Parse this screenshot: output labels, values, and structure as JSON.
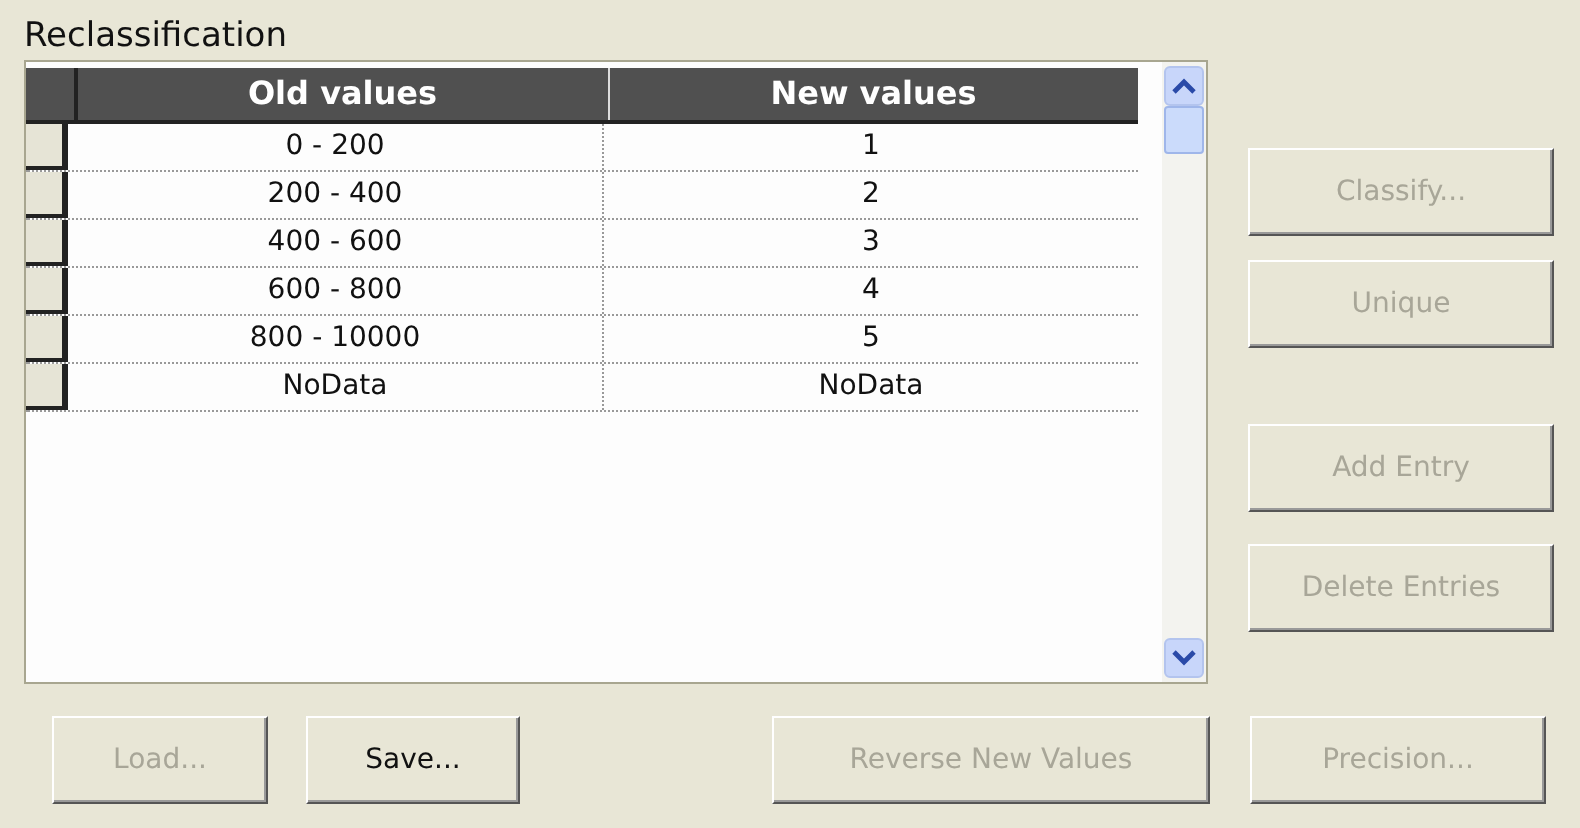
{
  "title": "Reclassification",
  "table": {
    "columns": [
      "Old values",
      "New values"
    ],
    "rows": [
      [
        "0 - 200",
        "1"
      ],
      [
        "200 - 400",
        "2"
      ],
      [
        "400 - 600",
        "3"
      ],
      [
        "600 - 800",
        "4"
      ],
      [
        "800 - 10000",
        "5"
      ],
      [
        "NoData",
        "NoData"
      ]
    ]
  },
  "side_buttons": [
    {
      "label": "Classify...",
      "disabled": true
    },
    {
      "label": "Unique",
      "disabled": true
    },
    {
      "label": "Add Entry",
      "disabled": true
    },
    {
      "label": "Delete Entries",
      "disabled": true
    }
  ],
  "bottom_buttons": [
    {
      "label": "Load...",
      "disabled": true
    },
    {
      "label": "Save...",
      "disabled": false
    },
    {
      "label": "Reverse New Values",
      "disabled": true
    },
    {
      "label": "Precision...",
      "disabled": true
    }
  ]
}
